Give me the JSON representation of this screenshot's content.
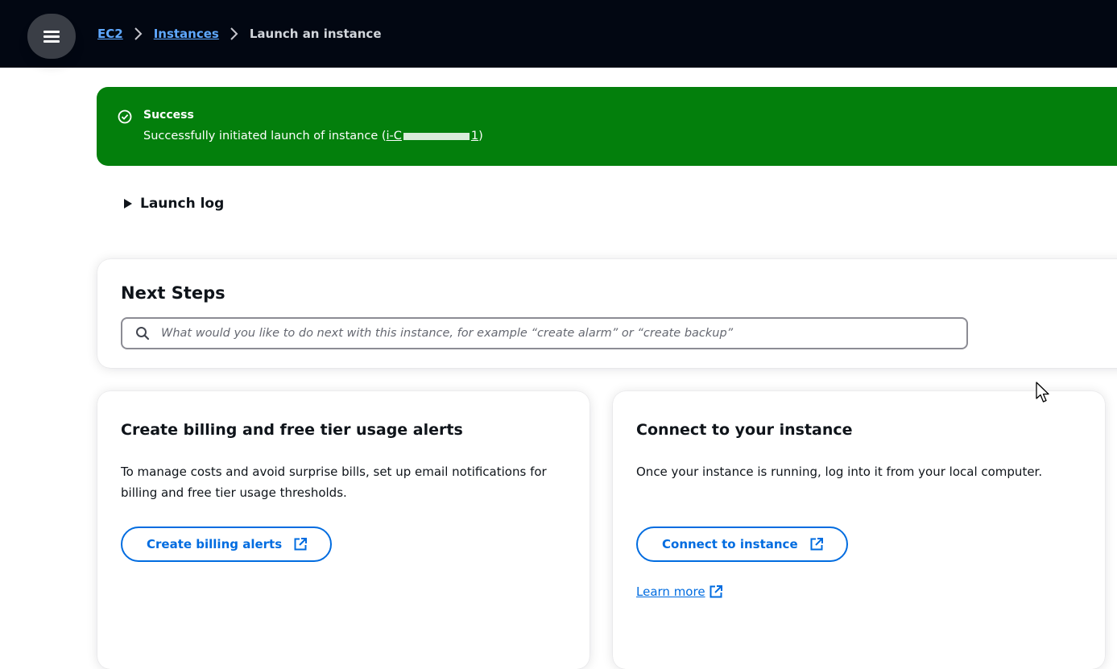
{
  "header": {
    "menu_icon": "hamburger-menu-icon",
    "breadcrumb": [
      {
        "label": "EC2",
        "link": true
      },
      {
        "label": "Instances",
        "link": true
      },
      {
        "label": "Launch an instance",
        "link": false
      }
    ]
  },
  "flash": {
    "status_icon": "check-circle-icon",
    "title": "Success",
    "message_prefix": "Successfully initiated launch of instance (",
    "instance_id_visible_start": "i-C",
    "instance_id_visible_end": "1",
    "message_suffix": ")",
    "color": "#037f0c"
  },
  "launch_log": {
    "label": "Launch log",
    "icon": "caret-right-icon"
  },
  "next_steps": {
    "title": "Next Steps",
    "search_placeholder": "What would you like to do next with this instance, for example “create alarm” or “create backup”",
    "search_icon": "search-icon"
  },
  "cards": [
    {
      "title": "Create billing and free tier usage alerts",
      "description": "To manage costs and avoid surprise bills, set up email notifications for billing and free tier usage thresholds.",
      "button_label": "Create billing alerts",
      "button_icon": "external-link-icon"
    },
    {
      "title": "Connect to your instance",
      "description": "Once your instance is running, log into it from your local computer.",
      "button_label": "Connect to instance",
      "button_icon": "external-link-icon",
      "link_label": "Learn more"
    }
  ],
  "colors": {
    "accent": "#006ce0",
    "topbar": "#020712",
    "link_dark": "#5fa8ff"
  }
}
